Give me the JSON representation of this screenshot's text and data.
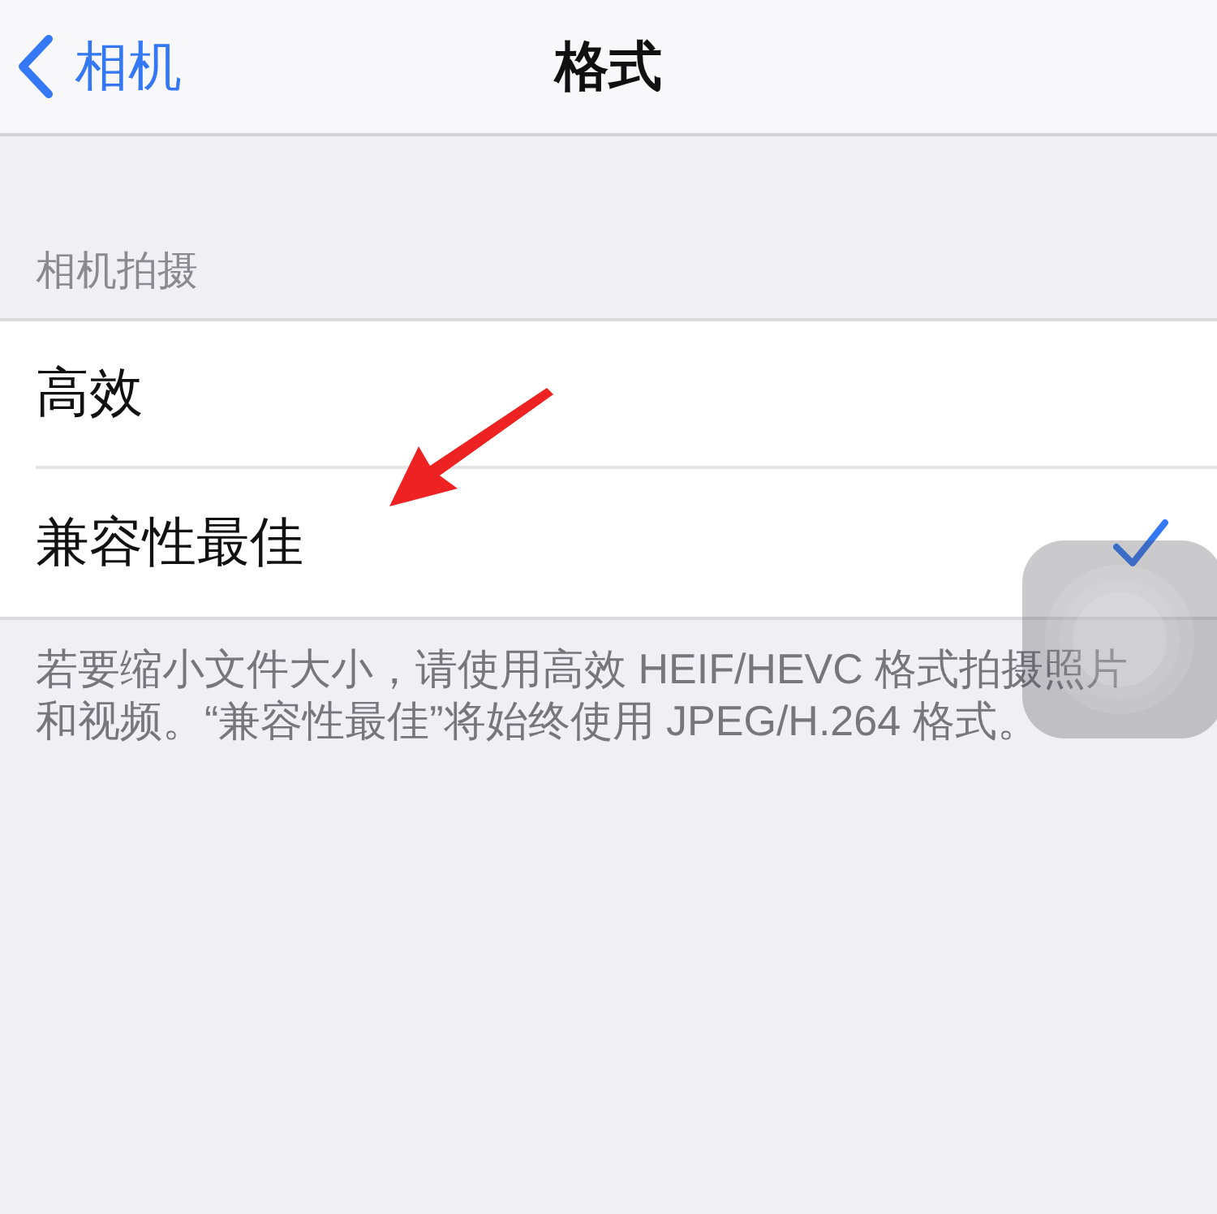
{
  "nav": {
    "back_label": "相机",
    "title": "格式"
  },
  "section": {
    "header": "相机拍摄",
    "options": [
      {
        "label": "高效",
        "selected": false
      },
      {
        "label": "兼容性最佳",
        "selected": true
      }
    ],
    "footer": "若要缩小文件大小，请使用高效 HEIF/HEVC 格式拍摄照片和视频。“兼容性最佳”将始终使用 JPEG/H.264 格式。"
  }
}
